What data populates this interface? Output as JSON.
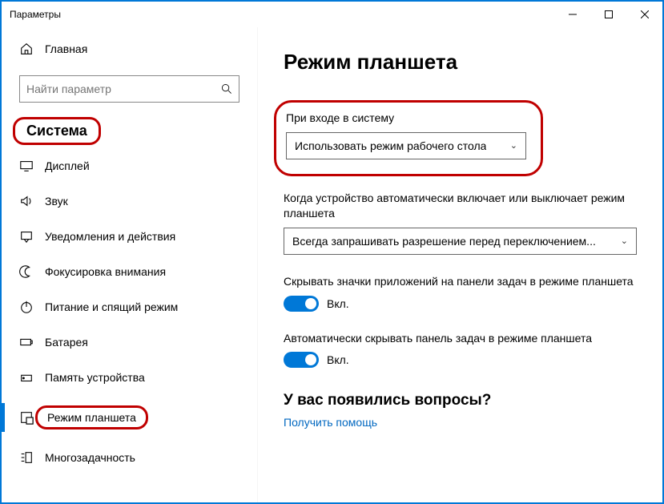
{
  "window": {
    "title": "Параметры"
  },
  "sidebar": {
    "home": "Главная",
    "search_placeholder": "Найти параметр",
    "section": "Система",
    "items": [
      {
        "label": "Дисплей"
      },
      {
        "label": "Звук"
      },
      {
        "label": "Уведомления и действия"
      },
      {
        "label": "Фокусировка внимания"
      },
      {
        "label": "Питание и спящий режим"
      },
      {
        "label": "Батарея"
      },
      {
        "label": "Память устройства"
      },
      {
        "label": "Режим планшета"
      },
      {
        "label": "Многозадачность"
      }
    ]
  },
  "content": {
    "title": "Режим планшета",
    "signin_label": "При входе в систему",
    "signin_value": "Использовать режим рабочего стола",
    "auto_label": "Когда устройство автоматически включает или выключает режим планшета",
    "auto_value": "Всегда запрашивать разрешение перед переключением...",
    "hide_icons_label": "Скрывать значки приложений на панели задач в режиме планшета",
    "hide_icons_state": "Вкл.",
    "auto_hide_taskbar_label": "Автоматически скрывать панель задач в режиме планшета",
    "auto_hide_taskbar_state": "Вкл.",
    "help_heading": "У вас появились вопросы?",
    "help_link": "Получить помощь"
  }
}
